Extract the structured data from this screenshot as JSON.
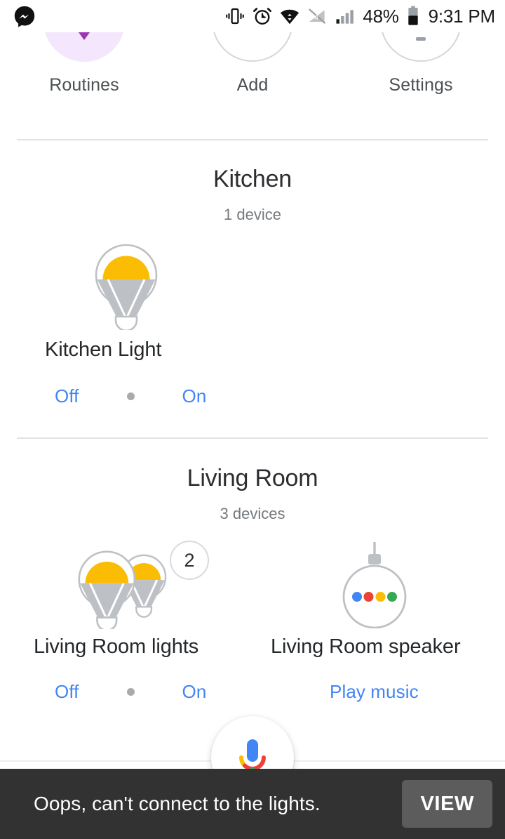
{
  "statusbar": {
    "icons": [
      "messenger-icon",
      "vibrate-icon",
      "alarm-icon",
      "wifi-icon",
      "mobile-data-off-icon",
      "signal-bars-icon"
    ],
    "battery_percent": "48%",
    "battery_icon": "battery-half-icon",
    "clock": "9:31 PM"
  },
  "shortcuts": [
    {
      "label": "Routines",
      "icon": "routines-icon",
      "style": "filled",
      "accent": "#9c35b1"
    },
    {
      "label": "Add",
      "icon": "add-icon",
      "style": "outlined",
      "accent": "#d4d6d8"
    },
    {
      "label": "Settings",
      "icon": "settings-icon",
      "style": "outlined",
      "accent": "#9aa0a6"
    }
  ],
  "sections": [
    {
      "title": "Kitchen",
      "subtitle": "1 device",
      "devices": [
        {
          "name": "Kitchen Light",
          "icon": "light-bulb-icon",
          "actions": [
            {
              "label": "Off",
              "type": "link"
            },
            {
              "label": "",
              "type": "dot"
            },
            {
              "label": "On",
              "type": "link"
            }
          ]
        }
      ]
    },
    {
      "title": "Living Room",
      "subtitle": "3 devices",
      "devices": [
        {
          "name": "Living Room lights",
          "icon": "light-bulb-group-icon",
          "badge": "2",
          "actions": [
            {
              "label": "Off",
              "type": "link"
            },
            {
              "label": "",
              "type": "dot"
            },
            {
              "label": "On",
              "type": "link"
            }
          ]
        },
        {
          "name": "Living Room speaker",
          "icon": "google-home-speaker-icon",
          "actions": [
            {
              "label": "Play music",
              "type": "link"
            }
          ]
        }
      ]
    }
  ],
  "fab": {
    "icon": "google-assistant-mic-icon"
  },
  "snackbar": {
    "message": "Oops, can't connect to the lights.",
    "action_label": "VIEW"
  },
  "colors": {
    "link_blue": "#4285f4",
    "bulb_amber": "#fbbc04",
    "bulb_gray": "#bdc1c6",
    "snackbar_bg": "#323232",
    "snackbar_button_bg": "#5c5c5c",
    "routines_fill": "#f4e6fd",
    "divider": "#e0e2e5"
  }
}
